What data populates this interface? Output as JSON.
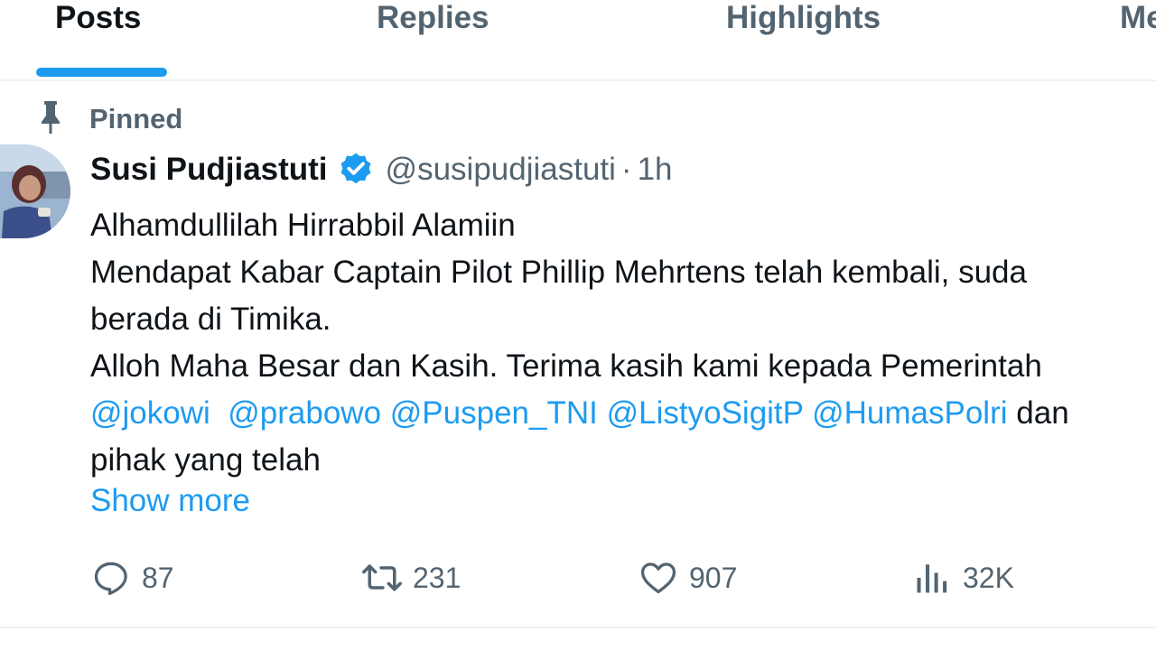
{
  "tabs": [
    {
      "label": "Posts",
      "active": true
    },
    {
      "label": "Replies",
      "active": false
    },
    {
      "label": "Highlights",
      "active": false
    },
    {
      "label": "Me",
      "active": false
    }
  ],
  "post": {
    "pinned_label": "Pinned",
    "author": {
      "display_name": "Susi Pudjiastuti",
      "handle": "@susipudjiastuti",
      "verified": true,
      "separator": "·",
      "timestamp": "1h"
    },
    "text": {
      "line1": "Alhamdullilah Hirrabbil Alamiin",
      "line2": "Mendapat Kabar Captain Pilot Phillip Mehrtens telah kembali, suda",
      "line3": "berada di Timika.",
      "line4": "Alloh Maha Besar dan Kasih. Terima kasih kami kepada Pemerintah",
      "mentions": [
        "@jokowi",
        "@prabowo",
        "@Puspen_TNI",
        "@ListyoSigitP",
        "@HumasPolri"
      ],
      "line5_tail": "dan",
      "line6": "pihak yang telah"
    },
    "show_more_label": "Show more",
    "actions": {
      "replies": "87",
      "reposts": "231",
      "likes": "907",
      "views": "32K"
    }
  },
  "icons": {
    "pin": "pin-icon",
    "verified": "verified-badge-icon",
    "reply": "reply-bubble-icon",
    "repost": "repost-arrows-icon",
    "like": "heart-icon",
    "views": "bar-chart-icon"
  },
  "colors": {
    "accent": "#1d9bf0",
    "text_primary": "#0f1419",
    "text_secondary": "#536471",
    "divider": "#eff3f4"
  }
}
